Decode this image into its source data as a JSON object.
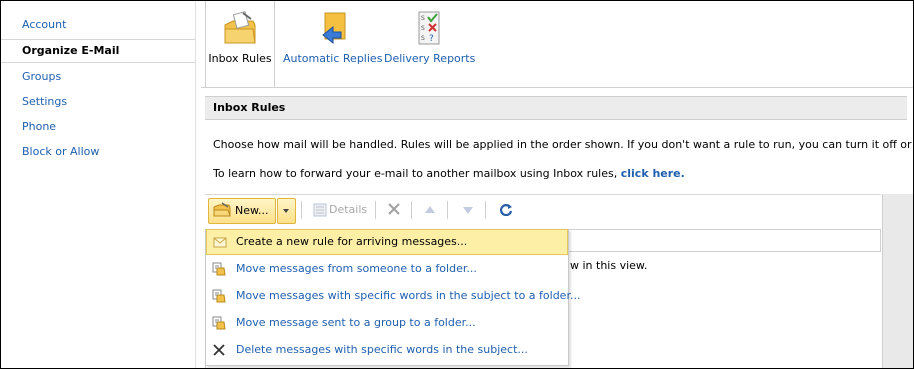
{
  "sidebar": {
    "items": [
      {
        "label": "Account"
      },
      {
        "label": "Organize E-Mail"
      },
      {
        "label": "Groups"
      },
      {
        "label": "Settings"
      },
      {
        "label": "Phone"
      },
      {
        "label": "Block or Allow"
      }
    ]
  },
  "top_toolbar": {
    "inbox_rules": "Inbox Rules",
    "automatic_replies": "Automatic Replies",
    "delivery_reports": "Delivery Reports"
  },
  "section": {
    "title": "Inbox Rules",
    "description": "Choose how mail will be handled. Rules will be applied in the order shown. If you don't want a rule to run, you can turn it off or delete it.",
    "forward_text": "To learn how to forward your e-mail to another mailbox using Inbox rules,",
    "forward_link": "click here."
  },
  "rules_toolbar": {
    "new_label": "New...",
    "details_label": "Details"
  },
  "grid": {
    "empty_fragment": "w in this view."
  },
  "menu": {
    "items": [
      {
        "label": "Create a new rule for arriving messages...",
        "icon": "envelope-icon"
      },
      {
        "label": "Move messages from someone to a folder...",
        "icon": "move-to-folder-icon"
      },
      {
        "label": "Move messages with specific words in the subject to a folder...",
        "icon": "move-to-folder-icon"
      },
      {
        "label": "Move message sent to a group to a folder...",
        "icon": "move-to-folder-icon"
      },
      {
        "label": "Delete messages with specific words in the subject...",
        "icon": "delete-x-icon"
      }
    ]
  },
  "colors": {
    "link": "#1f5faf",
    "highlight": "#fdf0a6",
    "button_gradient_top": "#fff5c8",
    "button_gradient_bottom": "#ffe08a"
  }
}
